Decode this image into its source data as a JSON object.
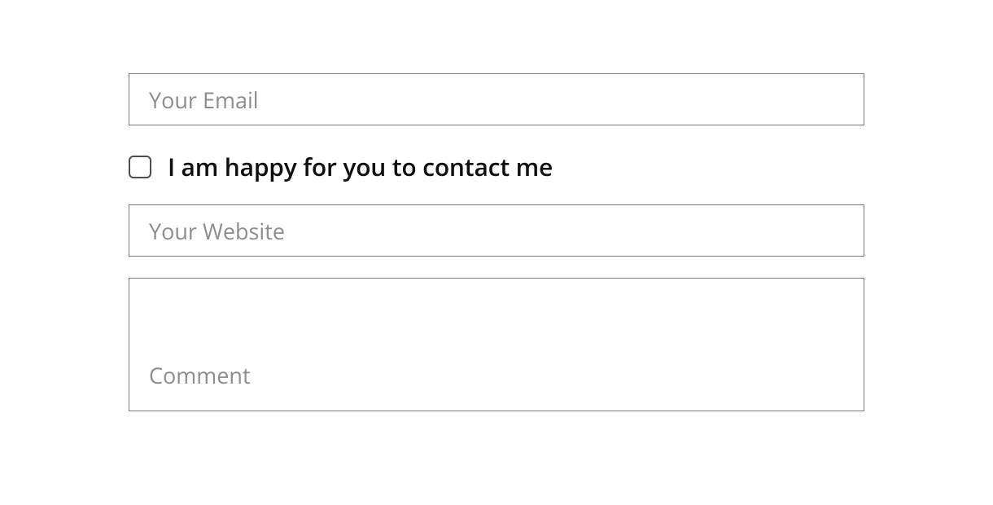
{
  "form": {
    "email": {
      "placeholder": "Your Email",
      "value": ""
    },
    "consent": {
      "label": "I am happy for you to contact me",
      "checked": false
    },
    "website": {
      "placeholder": "Your Website",
      "value": ""
    },
    "comment": {
      "placeholder": "Comment",
      "value": ""
    }
  }
}
